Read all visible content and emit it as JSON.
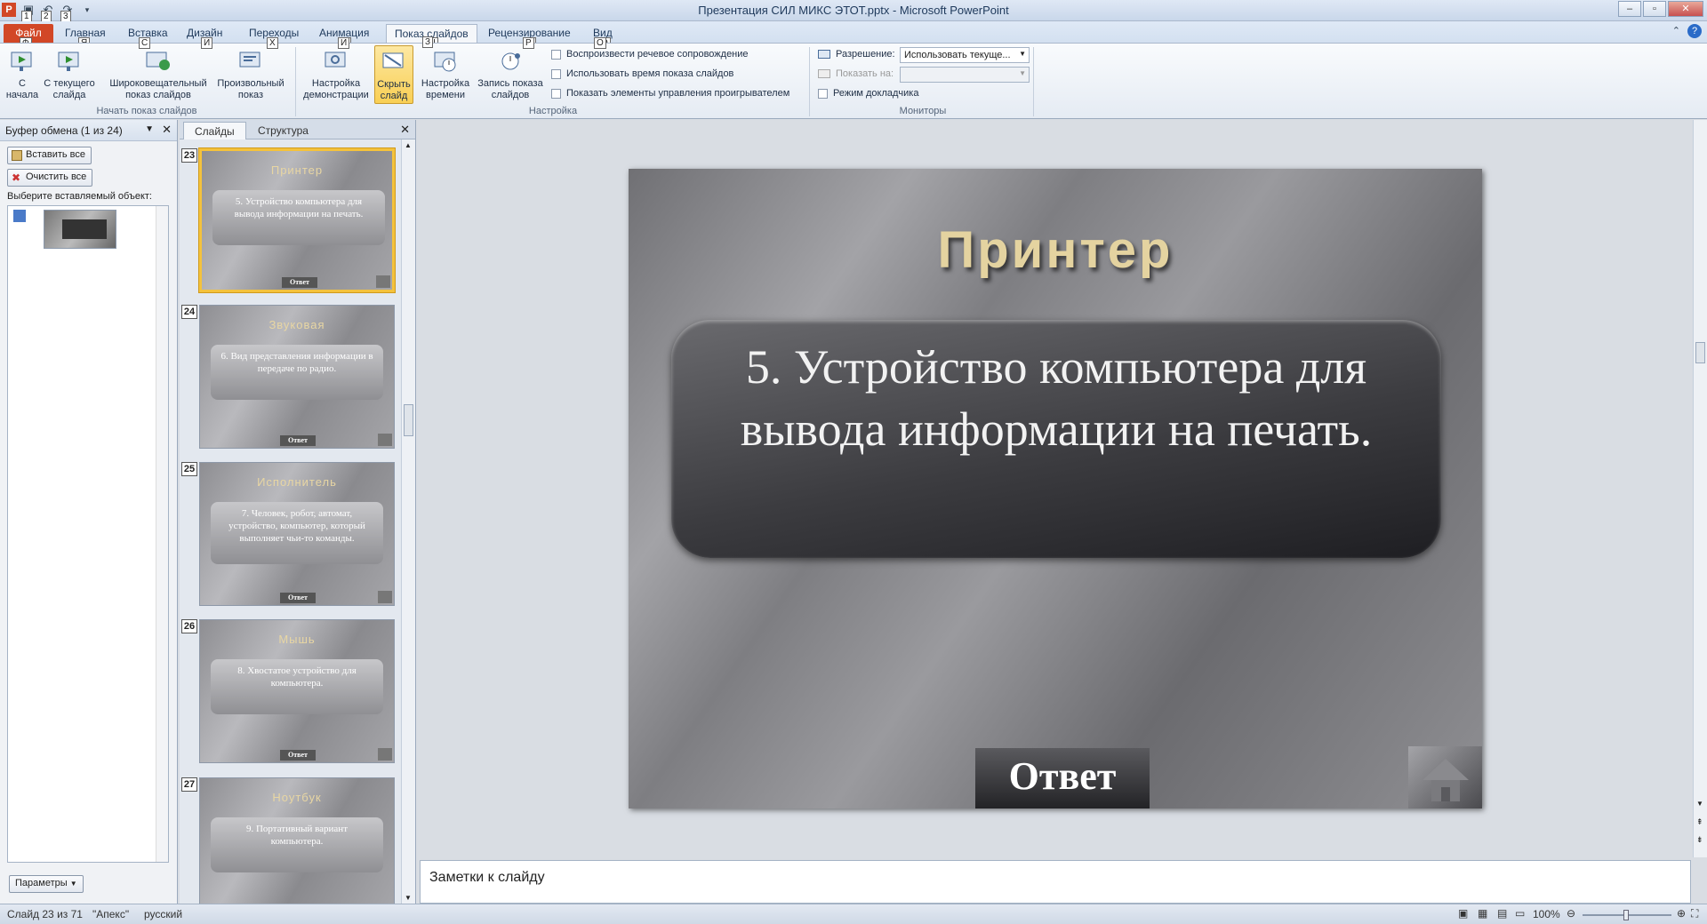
{
  "window": {
    "title": "Презентация СИЛ МИКС ЭТОТ.pptx - Microsoft PowerPoint",
    "app_icon": "P",
    "qat_hints": [
      "1",
      "2",
      "3"
    ]
  },
  "tabs": [
    {
      "label": "Файл",
      "hint": "Ф"
    },
    {
      "label": "Главная",
      "hint": "Я"
    },
    {
      "label": "Вставка",
      "hint": "С"
    },
    {
      "label": "Дизайн",
      "hint": "И"
    },
    {
      "label": "Переходы",
      "hint": "Х"
    },
    {
      "label": "Анимация",
      "hint": "И"
    },
    {
      "label": "Показ слайдов",
      "hint": "Ы"
    },
    {
      "label": "Рецензирование",
      "hint": "Р"
    },
    {
      "label": "Вид",
      "hint": "О"
    }
  ],
  "ribbon": {
    "start_group": {
      "label": "Начать показ слайдов",
      "from_start": "С начала",
      "from_current": "С текущего слайда",
      "broadcast": "Широковещательный показ слайдов",
      "custom": "Произвольный показ"
    },
    "setup_group": {
      "label": "Настройка",
      "setup_show": "Настройка демонстрации",
      "hide_slide": "Скрыть слайд",
      "rehearse": "Настройка времени",
      "record": "Запись показа слайдов",
      "play_narration": "Воспроизвести речевое сопровождение",
      "use_timings": "Использовать время показа слайдов",
      "show_controls": "Показать элементы управления проигрывателем"
    },
    "monitors_group": {
      "label": "Мониторы",
      "resolution_label": "Разрешение:",
      "resolution_value": "Использовать текуще...",
      "show_on_label": "Показать на:",
      "presenter_view": "Режим докладчика"
    }
  },
  "clipboard": {
    "title": "Буфер обмена (1 из 24)",
    "paste_all": "Вставить все",
    "clear_all": "Очистить все",
    "prompt": "Выберите вставляемый объект:",
    "options": "Параметры"
  },
  "slides_panel": {
    "tabs": [
      "Слайды",
      "Структура"
    ],
    "thumbs": [
      {
        "num": "23",
        "title": "Принтер",
        "text": "5. Устройство компьютера для вывода информации на печать.",
        "answer": "Ответ"
      },
      {
        "num": "24",
        "title": "Звуковая",
        "text": "6. Вид представления информации в передаче по радио.",
        "answer": "Ответ"
      },
      {
        "num": "25",
        "title": "Исполнитель",
        "text": "7. Человек, робот, автомат, устройство, компьютер, который выполняет чьи-то команды.",
        "answer": "Ответ"
      },
      {
        "num": "26",
        "title": "Мышь",
        "text": "8. Хвостатое устройство для компьютера.",
        "answer": "Ответ"
      },
      {
        "num": "27",
        "title": "Ноутбук",
        "text": "9. Портативный вариант компьютера.",
        "answer": ""
      }
    ]
  },
  "slide": {
    "title": "Принтер",
    "text": "5. Устройство компьютера для вывода информации на печать.",
    "answer": "Ответ"
  },
  "notes": {
    "placeholder": "Заметки к слайду"
  },
  "status": {
    "slide": "Слайд 23 из 71",
    "theme": "\"Апекс\"",
    "language": "русский",
    "zoom": "100%"
  }
}
